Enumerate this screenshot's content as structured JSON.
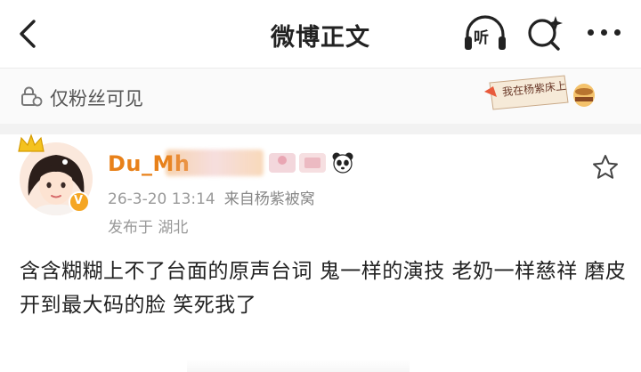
{
  "header": {
    "title": "微博正文",
    "listen_label": "听"
  },
  "visibility": {
    "text": "仅粉丝可见",
    "sticker_text": "我在杨紫床上"
  },
  "post": {
    "username": "Du_Mh",
    "timestamp": "26-3-20 13:14",
    "source": "来自杨紫被窝",
    "location": "发布于 湖北",
    "verified_mark": "V",
    "text": "含含糊糊上不了台面的原声台词 鬼一样的演技 老奶一样慈祥 磨皮开到最大码的脸 笑死我了"
  },
  "icons": [
    "back-arrow-icon",
    "headphones-icon",
    "search-icon",
    "more-icon",
    "lock-icon",
    "star-icon",
    "crown-icon",
    "panda-icon"
  ]
}
